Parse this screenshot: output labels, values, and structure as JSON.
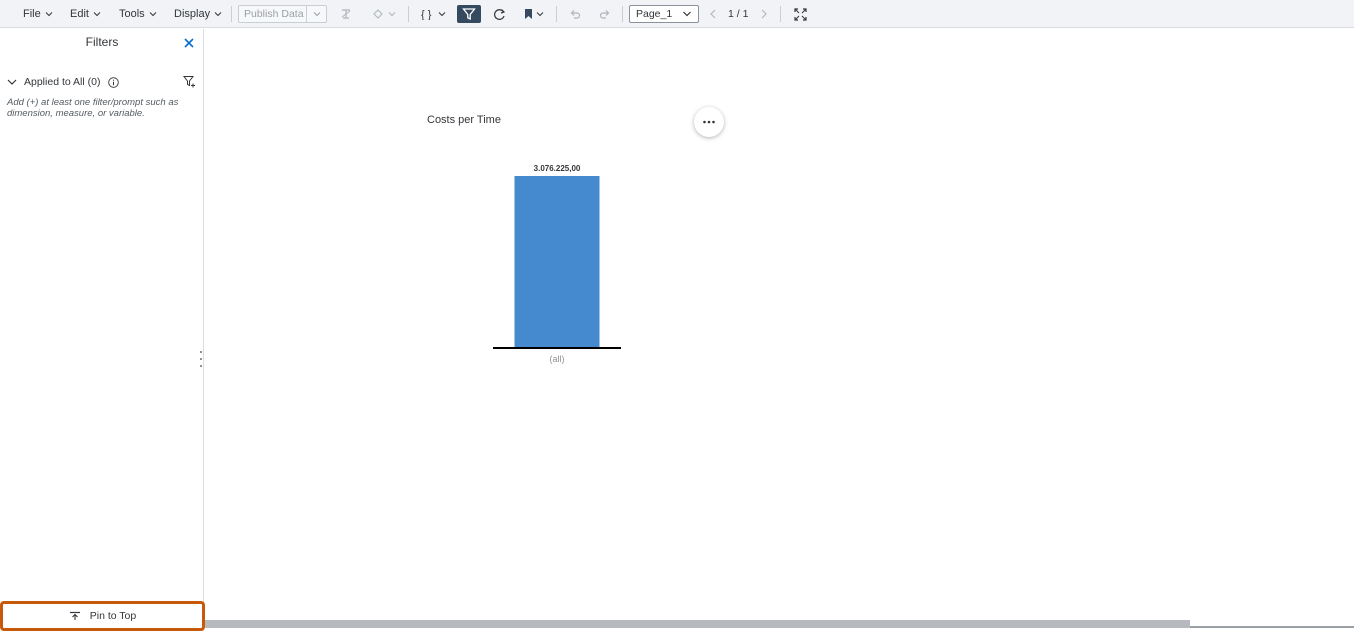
{
  "menu": {
    "file": "File",
    "edit": "Edit",
    "tools": "Tools",
    "display": "Display"
  },
  "toolbar": {
    "publish_label": "Publish Data",
    "page_select": "Page_1",
    "page_count": "1 / 1"
  },
  "filters": {
    "title": "Filters",
    "applied_label": "Applied to All (0)",
    "hint": "Add (+) at least one filter/prompt such as dimension, measure, or variable.",
    "pin_label": "Pin to Top"
  },
  "colors": {
    "bar": "#4589cf",
    "highlight": "#c8580a",
    "filter_active": "#354a5f"
  },
  "chart_data": {
    "type": "bar",
    "title": "Costs per Time",
    "categories": [
      "(all)"
    ],
    "values": [
      3076225
    ],
    "value_labels": [
      "3.076.225,00"
    ],
    "ylim": [
      0,
      3076225
    ]
  }
}
